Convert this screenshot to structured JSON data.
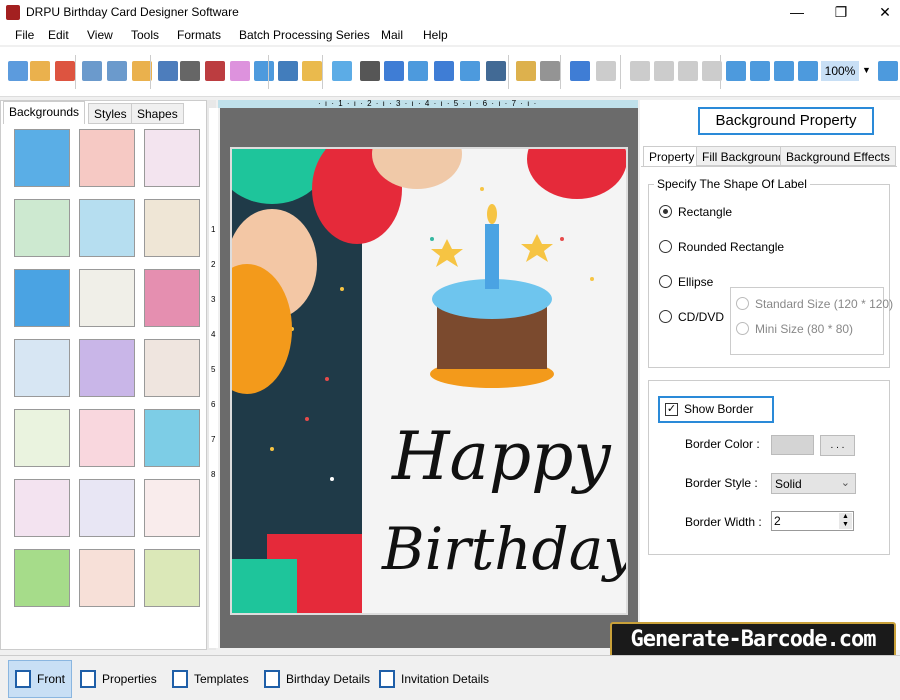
{
  "window": {
    "title": "DRPU Birthday Card Designer Software",
    "minimize": "—",
    "maximize": "❐",
    "close": "✕"
  },
  "menu": [
    "File",
    "Edit",
    "View",
    "Tools",
    "Formats",
    "Batch Processing Series",
    "Mail",
    "Help"
  ],
  "toolbar": {
    "zoom": "100%",
    "icons": [
      "new",
      "open",
      "close",
      "save",
      "save-as",
      "export",
      "properties",
      "print",
      "layers",
      "gift",
      "image",
      "pen",
      "shape",
      "watermark",
      "barcode",
      "text",
      "word-art",
      "signature",
      "email",
      "line",
      "database",
      "database-2",
      "undo",
      "redo",
      "cut",
      "copy",
      "paste",
      "delete",
      "grid",
      "actual-size",
      "fit",
      "zoom-in",
      "zoom-out"
    ]
  },
  "left": {
    "tabs": [
      "Backgrounds",
      "Styles",
      "Shapes"
    ],
    "thumb_colors": [
      "#5aaee6",
      "#f6c9c4",
      "#f3e4ef",
      "#cde9d0",
      "#b6def0",
      "#efe6d6",
      "#4aa3e3",
      "#f0efe8",
      "#e58fb0",
      "#d7e6f3",
      "#c9b6e8",
      "#efe5df",
      "#eaf3df",
      "#f9d7de",
      "#7dcde6",
      "#f3e3f0",
      "#e8e6f4",
      "#f9ecec",
      "#a6dc8a",
      "#f7e0d8",
      "#dbe8b8"
    ]
  },
  "ruler": {
    "h": "· ı · 1 · ı · 2 · ı · 3 · ı · 4 · ı · 5 · ı · 6 · ı · 7 · ı ·",
    "v": [
      "1",
      "2",
      "3",
      "4",
      "5",
      "6",
      "7",
      "8"
    ]
  },
  "card": {
    "line1": "Happy",
    "line2": "Birthday"
  },
  "right": {
    "title": "Background Property",
    "tabs": [
      "Property",
      "Fill Background",
      "Background Effects"
    ],
    "shape_group": "Specify The Shape Of Label",
    "shapes": [
      "Rectangle",
      "Rounded Rectangle",
      "Ellipse",
      "CD/DVD"
    ],
    "selected": "Rectangle",
    "cd_sizes": [
      "Standard Size (120 * 120)",
      "Mini Size (80 * 80)"
    ],
    "show_border": "Show Border",
    "show_border_checked": true,
    "border_color_label": "Border Color :",
    "border_color": "#d4d4d4",
    "browse": ". . .",
    "border_style_label": "Border Style :",
    "border_style": "Solid",
    "border_width_label": "Border Width :",
    "border_width": "2"
  },
  "bottom": [
    "Front",
    "Properties",
    "Templates",
    "Birthday Details",
    "Invitation Details"
  ],
  "watermark": "Generate-Barcode.com"
}
